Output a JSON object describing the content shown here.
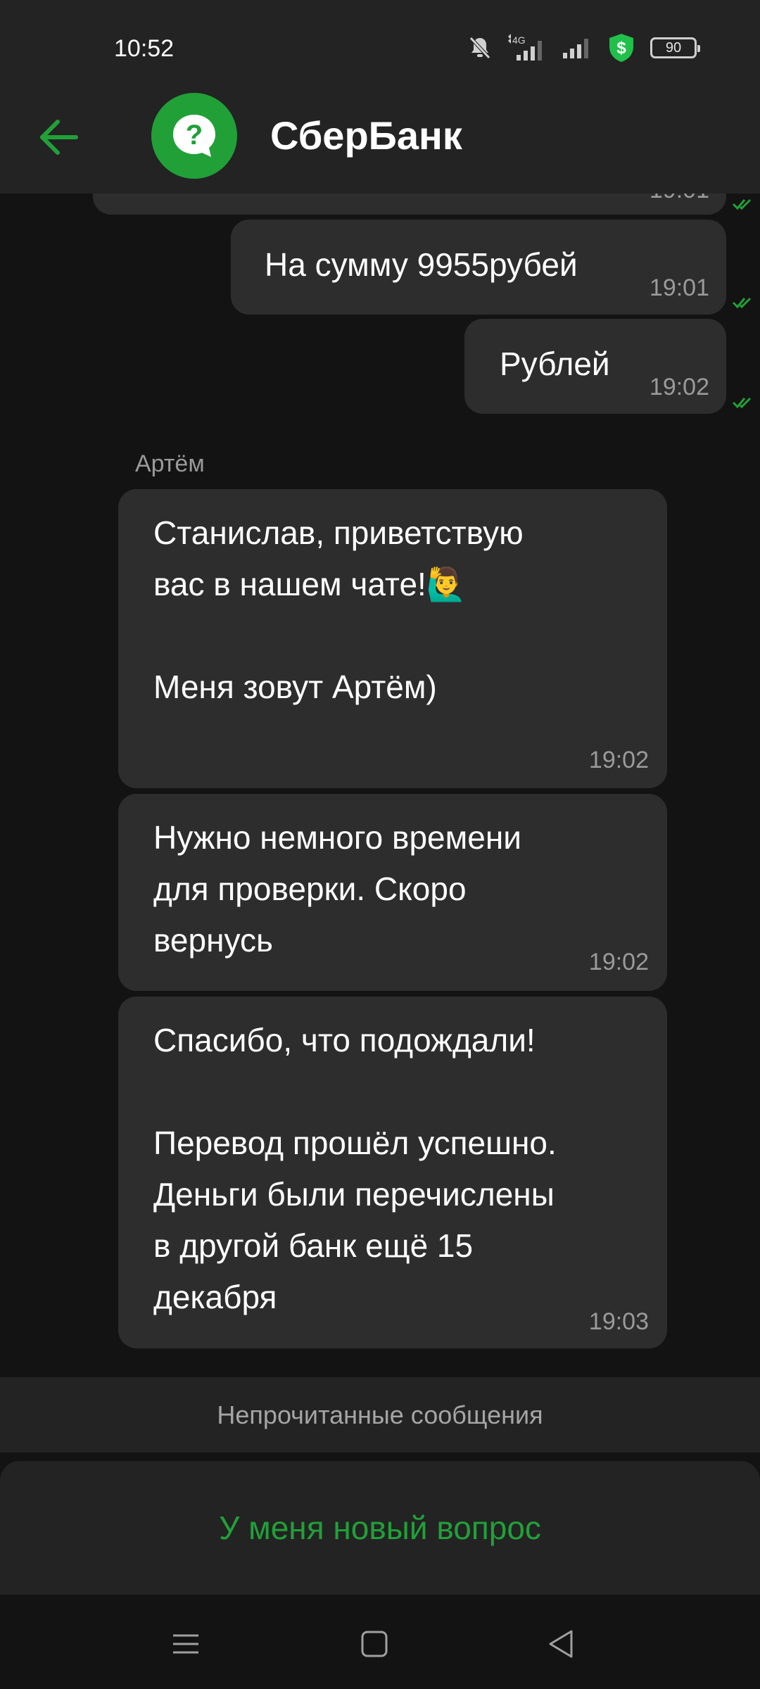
{
  "status_bar": {
    "time": "10:52",
    "network": "4G",
    "battery": "90",
    "icons": [
      "bell-off-icon",
      "signal-icon",
      "signal-icon",
      "shield-dollar-icon",
      "battery-icon"
    ]
  },
  "header": {
    "title": "СберБанк",
    "back_icon": "arrow-left-icon",
    "avatar_icon": "question-bubble-icon"
  },
  "messages": {
    "outgoing": [
      {
        "text": "",
        "time": "19:01"
      },
      {
        "text": "На сумму 9955рубей",
        "time": "19:01"
      },
      {
        "text": "Рублей",
        "time": "19:02"
      }
    ],
    "sender": "Артём",
    "incoming": [
      {
        "text": "Станислав, приветствую\nвас в нашем чате!🙋‍♂️\n\nМеня зовут Артём)",
        "time": "19:02"
      },
      {
        "text": "Нужно немного времени\nдля проверки. Скоро\nвернусь",
        "time": "19:02"
      },
      {
        "text": "Спасибо, что подождали!\n\nПеревод прошёл успешно.\nДеньги были перечислены\nв другой банк ещё 15\nдекабря",
        "time": "19:03"
      }
    ]
  },
  "unread_label": "Непрочитанные сообщения",
  "action_button": "У меня новый вопрос",
  "nav": {
    "icons": [
      "menu-icon",
      "home-square-icon",
      "back-triangle-icon"
    ]
  },
  "colors": {
    "accent": "#21a038",
    "background": "#131313",
    "surface": "#232323",
    "bubble": "#2d2d2d",
    "muted_text": "#9a9a9a"
  }
}
